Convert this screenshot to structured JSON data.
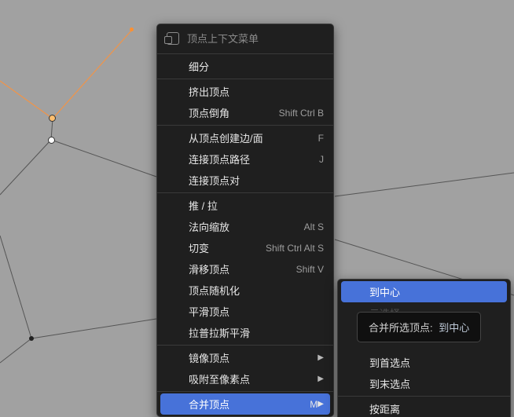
{
  "header": {
    "title": "顶点上下文菜单"
  },
  "groups": [
    [
      {
        "id": "subdivide",
        "label": "细分"
      }
    ],
    [
      {
        "id": "extrude",
        "label": "挤出顶点"
      },
      {
        "id": "bevel",
        "label": "顶点倒角",
        "shortcut": "Shift Ctrl B"
      }
    ],
    [
      {
        "id": "new-edge-face",
        "label": "从顶点创建边/面",
        "shortcut": "F"
      },
      {
        "id": "connect-path",
        "label": "连接顶点路径",
        "shortcut": "J"
      },
      {
        "id": "connect-pair",
        "label": "连接顶点对"
      }
    ],
    [
      {
        "id": "push-pull",
        "label": "推 / 拉"
      },
      {
        "id": "shrink-fatten",
        "label": "法向缩放",
        "shortcut": "Alt S"
      },
      {
        "id": "shear",
        "label": "切变",
        "shortcut": "Shift Ctrl Alt S"
      },
      {
        "id": "slide",
        "label": "滑移顶点",
        "shortcut": "Shift V"
      },
      {
        "id": "randomize",
        "label": "顶点随机化"
      },
      {
        "id": "smooth",
        "label": "平滑顶点"
      },
      {
        "id": "laplacian",
        "label": "拉普拉斯平滑"
      }
    ],
    [
      {
        "id": "mirror",
        "label": "镜像顶点",
        "submenu": true
      },
      {
        "id": "snap",
        "label": "吸附至像素点",
        "submenu": true
      }
    ],
    [
      {
        "id": "merge",
        "label": "合并顶点",
        "shortcut": "M",
        "submenu": true,
        "highlight": true
      }
    ]
  ],
  "submenu": {
    "highlight": {
      "id": "at-center",
      "label": "到中心"
    },
    "dim": {
      "id": "hidden",
      "label": "云选择"
    },
    "items": [
      {
        "id": "at-first",
        "label": "到首选点"
      },
      {
        "id": "at-last",
        "label": "到末选点"
      }
    ],
    "after": [
      {
        "id": "by-distance",
        "label": "按距离"
      }
    ]
  },
  "tooltip": {
    "prefix": "合并所选顶点:",
    "value": "到中心"
  }
}
